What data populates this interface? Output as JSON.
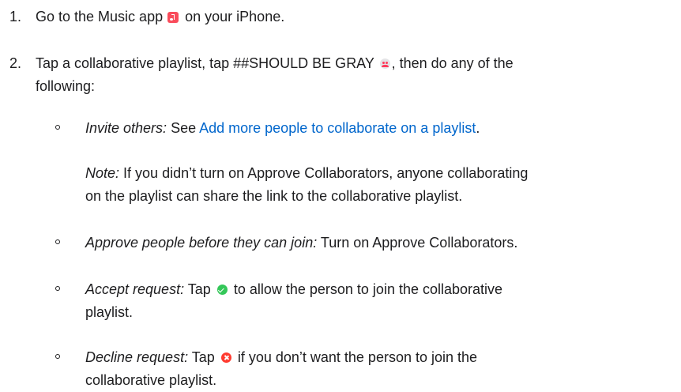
{
  "icons": {
    "music_app": "music-app-icon",
    "collaborate": "collaborate-icon",
    "accept": "checkmark-circle-icon",
    "decline": "x-circle-icon"
  },
  "colors": {
    "text": "#1d1d1f",
    "link": "#0066cc",
    "music_icon": "#f94c5b",
    "accept_icon": "#34c759",
    "decline_icon": "#ff3b30"
  },
  "steps": [
    {
      "number": "1.",
      "text_before_icon": "Go to the Music app",
      "text_after_icon": "on your iPhone."
    },
    {
      "number": "2.",
      "text_before_icon": "Tap a collaborative playlist, tap ##SHOULD BE GRAY",
      "text_after_icon": ", then do any of the",
      "text_line2": "following:"
    }
  ],
  "substeps": {
    "invite": {
      "label": "Invite others:",
      "text": "See",
      "link": "Add more people to collaborate on a playlist",
      "end": "."
    },
    "note": {
      "label": "Note:",
      "line1": "If you didn’t turn on Approve Collaborators, anyone collaborating",
      "line2": "on the playlist can share the link to the collaborative playlist."
    },
    "approve": {
      "label": "Approve people before they can join:",
      "text": "Turn on Approve Collaborators."
    },
    "accept": {
      "label": "Accept request:",
      "text_before_icon": "Tap",
      "text_after_icon": "to allow the person to join the collaborative",
      "line2": "playlist."
    },
    "decline": {
      "label": "Decline request:",
      "text_before_icon": "Tap",
      "text_after_icon": "if you don’t want the person to join the",
      "line2": "collaborative playlist."
    }
  }
}
